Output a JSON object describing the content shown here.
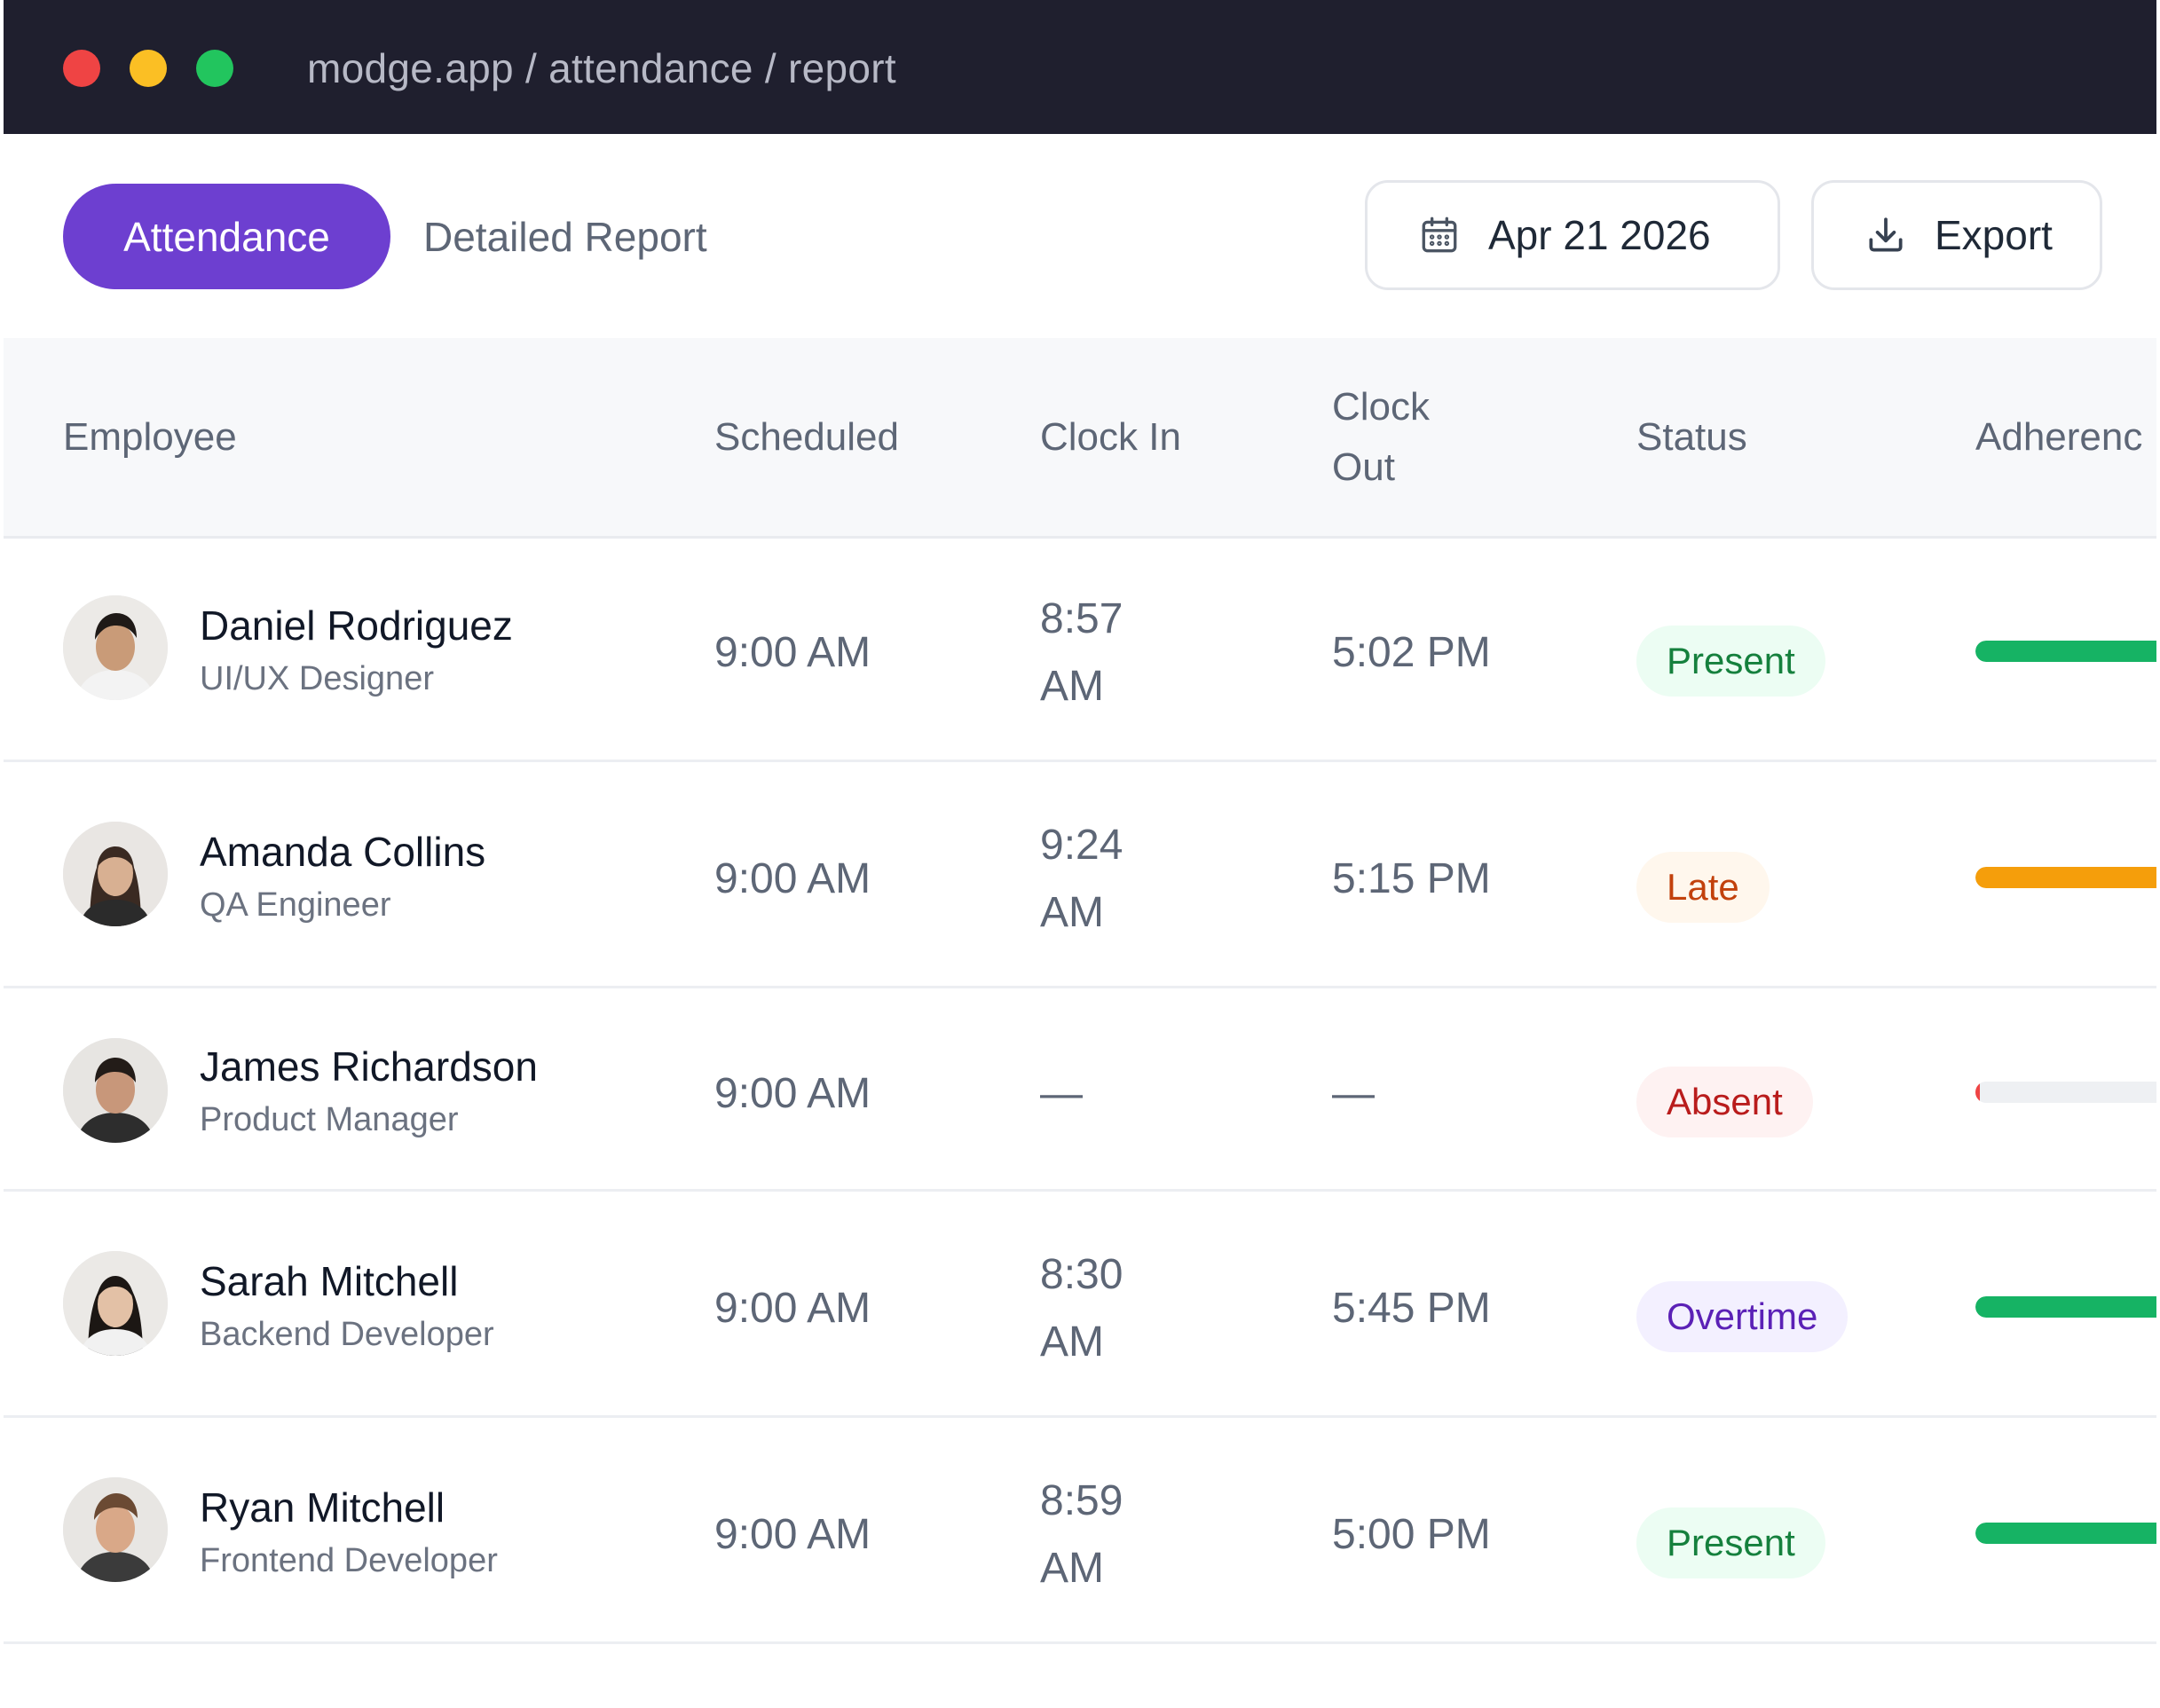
{
  "browser": {
    "url": "modge.app / attendance / report"
  },
  "toolbar": {
    "tabs": [
      {
        "label": "Attendance",
        "active": true
      },
      {
        "label": "Detailed Report",
        "active": false
      }
    ],
    "date_label": "Apr 21 2026",
    "export_label": "Export"
  },
  "table": {
    "headers": {
      "employee": "Employee",
      "scheduled": "Scheduled",
      "clock_in": "Clock In",
      "clock_out": "Clock Out",
      "status": "Status",
      "adherence": "Adherenc"
    },
    "rows": [
      {
        "name": "Daniel Rodriguez",
        "role": "UI/UX Designer",
        "scheduled": "9:00 AM",
        "clock_in": "8:57 AM",
        "clock_out": "5:02 PM",
        "status": "Present",
        "status_kind": "present",
        "adherence": 1.0,
        "adherence_color": "#16b364"
      },
      {
        "name": "Amanda Collins",
        "role": "QA Engineer",
        "scheduled": "9:00 AM",
        "clock_in": "9:24 AM",
        "clock_out": "5:15 PM",
        "status": "Late",
        "status_kind": "late",
        "adherence": 0.95,
        "adherence_color": "#f59e0b"
      },
      {
        "name": "James Richardson",
        "role": "Product Manager",
        "scheduled": "9:00 AM",
        "clock_in": "—",
        "clock_out": "—",
        "status": "Absent",
        "status_kind": "absent",
        "adherence": 0.02,
        "adherence_color": "#ef4444"
      },
      {
        "name": "Sarah Mitchell",
        "role": "Backend Developer",
        "scheduled": "9:00 AM",
        "clock_in": "8:30 AM",
        "clock_out": "5:45 PM",
        "status": "Overtime",
        "status_kind": "overtime",
        "adherence": 1.0,
        "adherence_color": "#16b364"
      },
      {
        "name": "Ryan Mitchell",
        "role": "Frontend Developer",
        "scheduled": "9:00 AM",
        "clock_in": "8:59 AM",
        "clock_out": "5:00 PM",
        "status": "Present",
        "status_kind": "present",
        "adherence": 1.0,
        "adherence_color": "#16b364"
      }
    ]
  },
  "colors": {
    "accent": "#6d3fd0",
    "titlebar": "#1f1f2e"
  }
}
